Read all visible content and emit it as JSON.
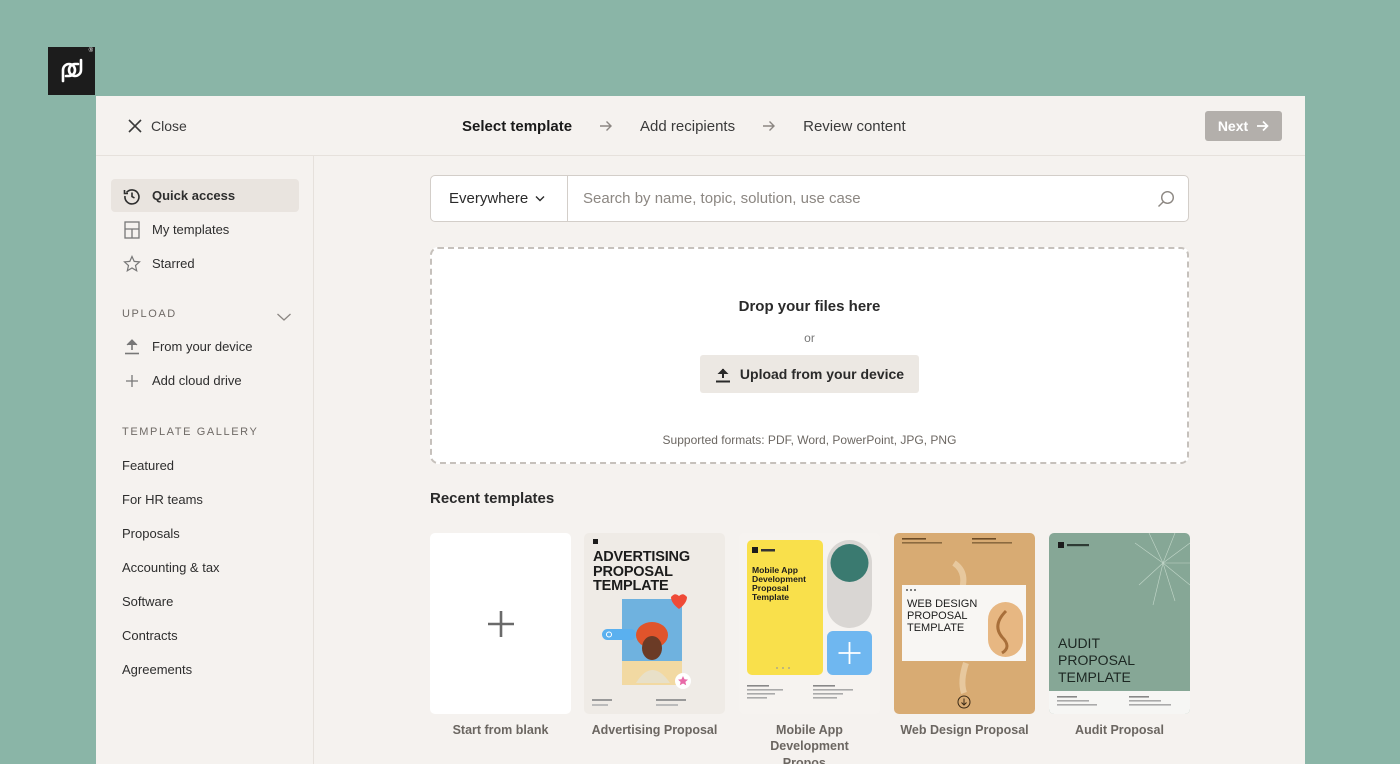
{
  "header": {
    "close_label": "Close",
    "steps": [
      "Select template",
      "Add recipients",
      "Review content"
    ],
    "next_label": "Next"
  },
  "sidebar": {
    "items": [
      {
        "label": "Quick access",
        "icon": "history-icon",
        "active": true
      },
      {
        "label": "My templates",
        "icon": "document-template-icon"
      },
      {
        "label": "Starred",
        "icon": "star-icon"
      }
    ],
    "upload_heading": "UPLOAD",
    "upload_items": [
      {
        "label": "From your device",
        "icon": "upload-icon"
      },
      {
        "label": "Add cloud drive",
        "icon": "plus-icon"
      }
    ],
    "gallery_heading": "TEMPLATE GALLERY",
    "gallery_items": [
      "Featured",
      "For HR teams",
      "Proposals",
      "Accounting & tax",
      "Software",
      "Contracts",
      "Agreements"
    ]
  },
  "search": {
    "scope": "Everywhere",
    "placeholder": "Search by name, topic, solution, use case"
  },
  "dropzone": {
    "title": "Drop your files here",
    "or": "or",
    "button": "Upload from your device",
    "formats": "Supported formats: PDF, Word, PowerPoint, JPG, PNG"
  },
  "recent": {
    "title": "Recent templates",
    "items": [
      {
        "label": "Start from blank"
      },
      {
        "label": "Advertising Proposal",
        "thumb_title": "ADVERTISING PROPOSAL TEMPLATE"
      },
      {
        "label": "Mobile App Development Propos...",
        "thumb_title": "Mobile App Development Proposal Template"
      },
      {
        "label": "Web Design Proposal",
        "thumb_title": "WEB DESIGN PROPOSAL TEMPLATE"
      },
      {
        "label": "Audit Proposal",
        "thumb_title": "AUDIT PROPOSAL TEMPLATE"
      }
    ]
  },
  "colors": {
    "page_background": "#8ab5a7",
    "app_background": "#f5f2ef",
    "next_disabled": "#b3afab",
    "mobile_yellow": "#f9e04b",
    "mobile_teal": "#3a7a70",
    "mobile_blue": "#6fb7f0",
    "web_orange": "#d8ab73",
    "audit_green": "#86a796"
  }
}
